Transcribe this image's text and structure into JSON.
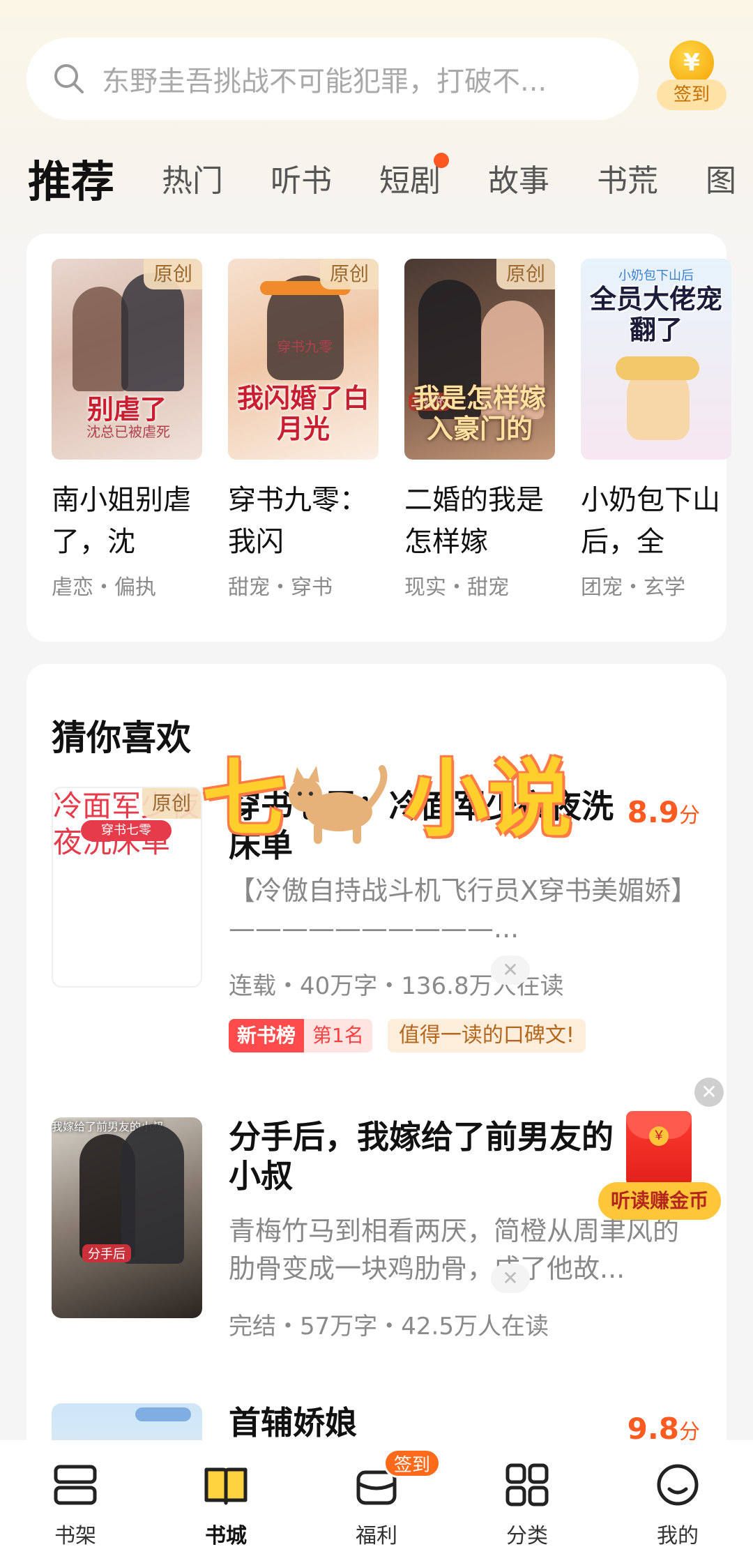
{
  "search": {
    "placeholder": "东野圭吾挑战不可能犯罪，打破不..."
  },
  "signin": {
    "label": "签到",
    "coin_symbol": "¥"
  },
  "tabs": [
    "推荐",
    "热门",
    "听书",
    "短剧",
    "故事",
    "书荒",
    "图"
  ],
  "recommended": [
    {
      "title": "南小姐别虐了，沈",
      "tags": "虐恋・偏执",
      "badge": "原创",
      "cover_text": "别虐了",
      "cover_sub": "沈总已被虐死"
    },
    {
      "title": "穿书九零：我闪",
      "tags": "甜宠・穿书",
      "badge": "原创",
      "cover_text": "我闪婚了白月光",
      "cover_sub": "穿书九零"
    },
    {
      "title": "二婚的我是怎样嫁",
      "tags": "现实・甜宠",
      "badge": "原创",
      "cover_text": "我是怎样嫁入豪门的",
      "cover_sub": "二婚的"
    },
    {
      "title": "小奶包下山后，全",
      "tags": "团宠・玄学",
      "badge": "",
      "cover_text": "全员大佬宠翻了",
      "cover_sub": "小奶包下山后"
    }
  ],
  "guess": {
    "title": "猜你喜欢",
    "items": [
      {
        "title": "穿书七零：冷面军少夜夜洗床单",
        "score": "8.9",
        "score_unit": "分",
        "badge": "原创",
        "cover_text": "冷面军少夜夜洗床单",
        "cover_sub": "穿书七零",
        "desc": "【冷傲自持战斗机飞行员X穿书美媚娇】——————————...",
        "meta": "连载・40万字・136.8万人在读",
        "chip_rank_label": "新书榜",
        "chip_rank_value": "第1名",
        "chip_note": "值得一读的口碑文!"
      },
      {
        "title": "分手后，我嫁给了前男友的小叔",
        "score": "",
        "score_unit": "",
        "cover_text": "我嫁给了前男友的小叔",
        "cover_sub": "分手后",
        "desc": "青梅竹马到相看两厌，简橙从周聿风的肋骨变成一块鸡肋骨，成了他故...",
        "meta": "完结・57万字・42.5万人在读"
      },
      {
        "title": "首辅娇娘",
        "score": "9.8",
        "score_unit": "分"
      }
    ]
  },
  "watermark": {
    "part1": "七",
    "part2": "小说"
  },
  "red_packet": {
    "label": "听读赚金币"
  },
  "nav": [
    {
      "label": "书架",
      "icon": "bookshelf-icon"
    },
    {
      "label": "书城",
      "icon": "book-open-icon"
    },
    {
      "label": "福利",
      "icon": "gift-icon",
      "badge": "签到"
    },
    {
      "label": "分类",
      "icon": "grid-icon"
    },
    {
      "label": "我的",
      "icon": "profile-icon"
    }
  ],
  "colors": {
    "accent": "#ff5a1f",
    "brand_yellow": "#ffd23f",
    "badge_red": "#ff4b4b"
  }
}
